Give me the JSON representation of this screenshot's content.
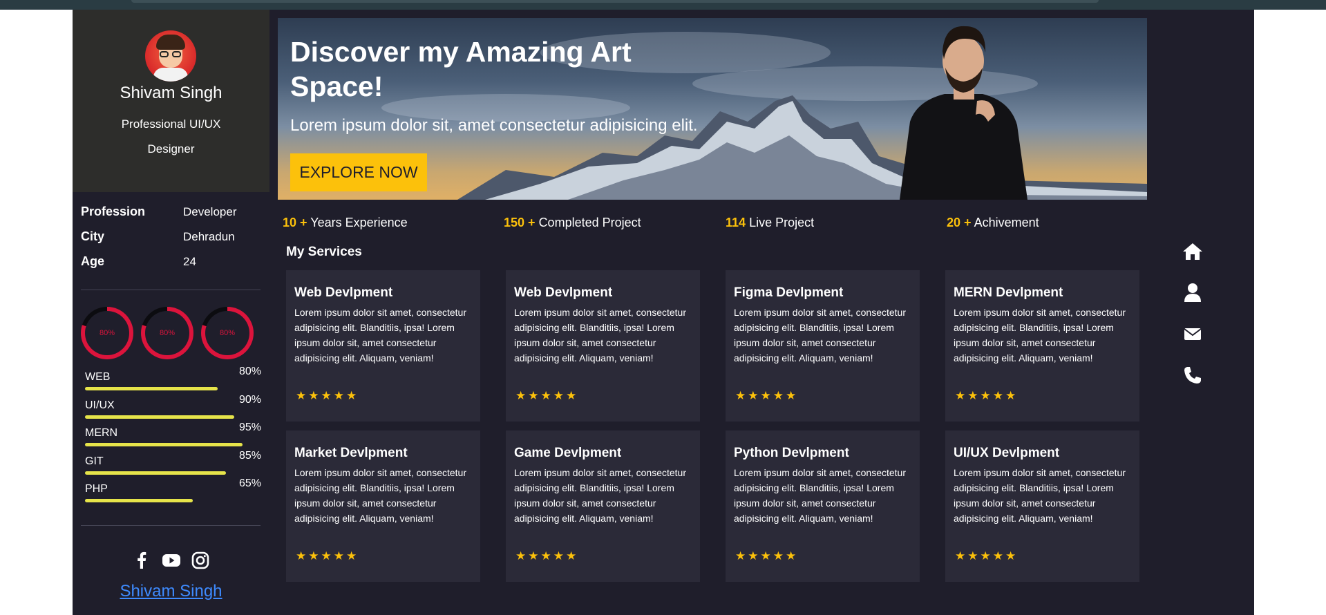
{
  "profile": {
    "name": "Shivam Singh",
    "role": "Professional UI/UX Designer"
  },
  "info": [
    {
      "key": "Profession",
      "value": "Developer"
    },
    {
      "key": "City",
      "value": "Dehradun"
    },
    {
      "key": "Age",
      "value": "24"
    }
  ],
  "circles": [
    "80%",
    "80%",
    "80%"
  ],
  "skills": [
    {
      "name": "WEB",
      "percent": "80%",
      "level": 80
    },
    {
      "name": "UI/UX",
      "percent": "90%",
      "level": 90
    },
    {
      "name": "MERN",
      "percent": "95%",
      "level": 95
    },
    {
      "name": "GIT",
      "percent": "85%",
      "level": 85
    },
    {
      "name": "PHP",
      "percent": "65%",
      "level": 65
    }
  ],
  "social": {
    "icons": [
      "facebook-icon",
      "youtube-icon",
      "instagram-icon"
    ],
    "link_text": "Shivam Singh"
  },
  "hero": {
    "title": "Discover my Amazing Art Space!",
    "subtitle": "Lorem ipsum dolor sit, amet consectetur adipisicing elit.",
    "button": "EXPLORE NOW"
  },
  "stats": [
    {
      "num": "10 +",
      "label": "Years Experience"
    },
    {
      "num": "150 +",
      "label": "Completed Project"
    },
    {
      "num": "114",
      "label": "Live Project"
    },
    {
      "num": "20 +",
      "label": "Achivement"
    }
  ],
  "services_title": "My Services",
  "services": [
    {
      "title": "Web Devlpment",
      "text": "Lorem ipsum dolor sit amet, consectetur adipisicing elit. Blanditiis, ipsa! Lorem ipsum dolor sit, amet consectetur adipisicing elit. Aliquam, veniam!",
      "stars": "★★★★★"
    },
    {
      "title": "Web Devlpment",
      "text": "Lorem ipsum dolor sit amet, consectetur adipisicing elit. Blanditiis, ipsa! Lorem ipsum dolor sit, amet consectetur adipisicing elit. Aliquam, veniam!",
      "stars": "★★★★★"
    },
    {
      "title": "Figma Devlpment",
      "text": "Lorem ipsum dolor sit amet, consectetur adipisicing elit. Blanditiis, ipsa! Lorem ipsum dolor sit, amet consectetur adipisicing elit. Aliquam, veniam!",
      "stars": "★★★★★"
    },
    {
      "title": "MERN Devlpment",
      "text": "Lorem ipsum dolor sit amet, consectetur adipisicing elit. Blanditiis, ipsa! Lorem ipsum dolor sit, amet consectetur adipisicing elit. Aliquam, veniam!",
      "stars": "★★★★★"
    },
    {
      "title": "Market Devlpment",
      "text": "Lorem ipsum dolor sit amet, consectetur adipisicing elit. Blanditiis, ipsa! Lorem ipsum dolor sit, amet consectetur adipisicing elit. Aliquam, veniam!",
      "stars": "★★★★★"
    },
    {
      "title": "Game Devlpment",
      "text": "Lorem ipsum dolor sit amet, consectetur adipisicing elit. Blanditiis, ipsa! Lorem ipsum dolor sit, amet consectetur adipisicing elit. Aliquam, veniam!",
      "stars": "★★★★★"
    },
    {
      "title": "Python Devlpment",
      "text": "Lorem ipsum dolor sit amet, consectetur adipisicing elit. Blanditiis, ipsa! Lorem ipsum dolor sit, amet consectetur adipisicing elit. Aliquam, veniam!",
      "stars": "★★★★★"
    },
    {
      "title": "UI/UX Devlpment",
      "text": "Lorem ipsum dolor sit amet, consectetur adipisicing elit. Blanditiis, ipsa! Lorem ipsum dolor sit, amet consectetur adipisicing elit. Aliquam, veniam!",
      "stars": "★★★★★"
    }
  ],
  "right_nav": [
    "home-icon",
    "user-icon",
    "envelope-icon",
    "phone-icon"
  ],
  "colors": {
    "background": "#1f1e2b",
    "accent": "#fcc10b",
    "card": "#2b2a38",
    "progress": "#dc143c",
    "skill_bar": "#e6e44a",
    "link": "#3e8bff"
  }
}
